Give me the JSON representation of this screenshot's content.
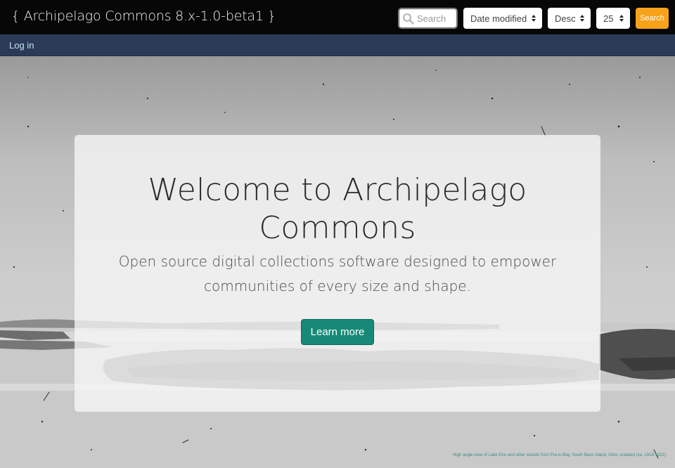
{
  "header": {
    "site_title": "{ Archipelago Commons 8.x-1.0-beta1 }",
    "search_placeholder": "Search",
    "sort_by": {
      "selected": "Date modified"
    },
    "sort_order": {
      "selected": "Desc"
    },
    "items_per_page": {
      "selected": "25"
    },
    "search_button_label": "Search"
  },
  "nav": {
    "login_label": "Log in"
  },
  "hero": {
    "title": "Welcome to Archipelago Commons",
    "tagline": "Open source digital collections software designed to empower communities of every size and shape.",
    "cta_label": "Learn more",
    "image_caption": "High angle view of Lake Erie and other islands from Put-in-Bay, South Bass Island, Ohio, undated (ca. 1918-1922)"
  },
  "colors": {
    "topbar_bg": "#070707",
    "navbar_bg": "#2b3b57",
    "search_button": "#f7a21b",
    "cta_button": "#168a76",
    "link": "#c8e6f2"
  },
  "icons": {
    "search_field_icon": "search-icon",
    "select_caret": "updown-caret-icon"
  }
}
